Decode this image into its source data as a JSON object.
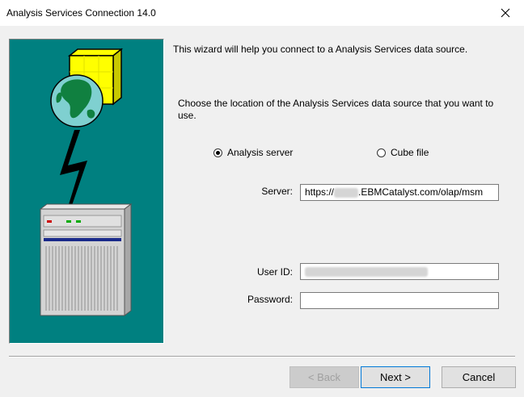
{
  "window": {
    "title": "Analysis Services Connection 14.0"
  },
  "wizard": {
    "intro": "This wizard will help you connect to a Analysis Services data source.",
    "choose_location": "Choose the location of the Analysis Services data source that you want to use."
  },
  "location_options": {
    "analysis_server": {
      "label": "Analysis server",
      "selected": true
    },
    "cube_file": {
      "label": "Cube file",
      "selected": false
    }
  },
  "server": {
    "label": "Server:",
    "value_prefix": "https://",
    "value_suffix": ".EBMCatalyst.com/olap/msm"
  },
  "user_id": {
    "label": "User ID:"
  },
  "password": {
    "label": "Password:",
    "value": ""
  },
  "buttons": {
    "back": "< Back",
    "next": "Next >",
    "cancel": "Cancel"
  },
  "colors": {
    "art_background": "#008080",
    "cube": "#ffff00",
    "globe_sea": "#7fd0d0",
    "globe_land": "#108040"
  }
}
